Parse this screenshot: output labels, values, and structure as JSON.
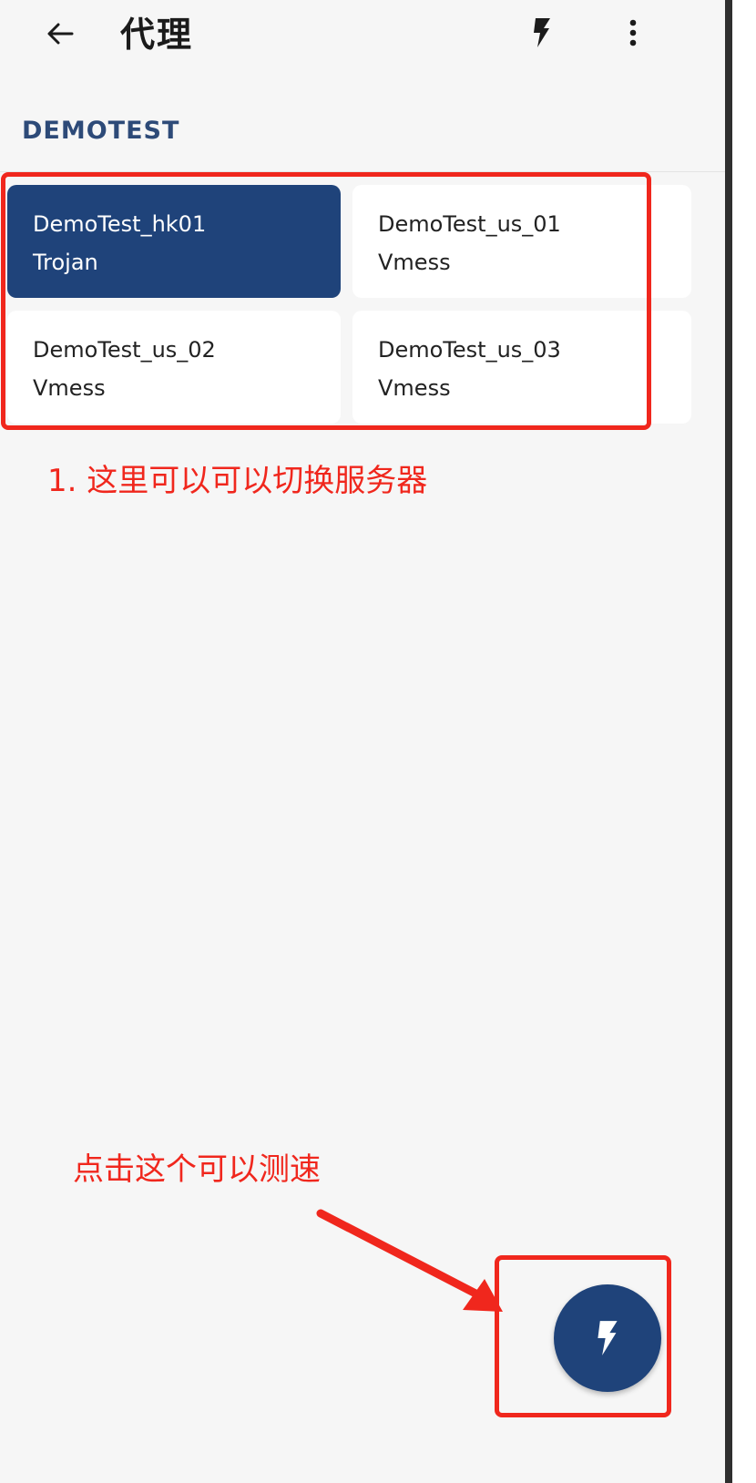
{
  "topbar": {
    "title": "代理",
    "back_icon": "arrow-left-icon",
    "test_icon": "lightning-bolt-icon",
    "more_icon": "more-vertical-icon"
  },
  "group": {
    "name": "DEMOTEST"
  },
  "servers": [
    {
      "name": "DemoTest_hk01",
      "type": "Trojan",
      "selected": true
    },
    {
      "name": "DemoTest_us_01",
      "type": "Vmess",
      "selected": false
    },
    {
      "name": "DemoTest_us_02",
      "type": "Vmess",
      "selected": false
    },
    {
      "name": "DemoTest_us_03",
      "type": "Vmess",
      "selected": false
    }
  ],
  "annotations": {
    "switch_server": "1. 这里可以可以切换服务器",
    "speed_test": "点击这个可以测速"
  },
  "fab": {
    "icon": "lightning-bolt-icon"
  },
  "colors": {
    "accent": "#1f437a",
    "annotation": "#f0271d",
    "background": "#f6f6f6"
  }
}
